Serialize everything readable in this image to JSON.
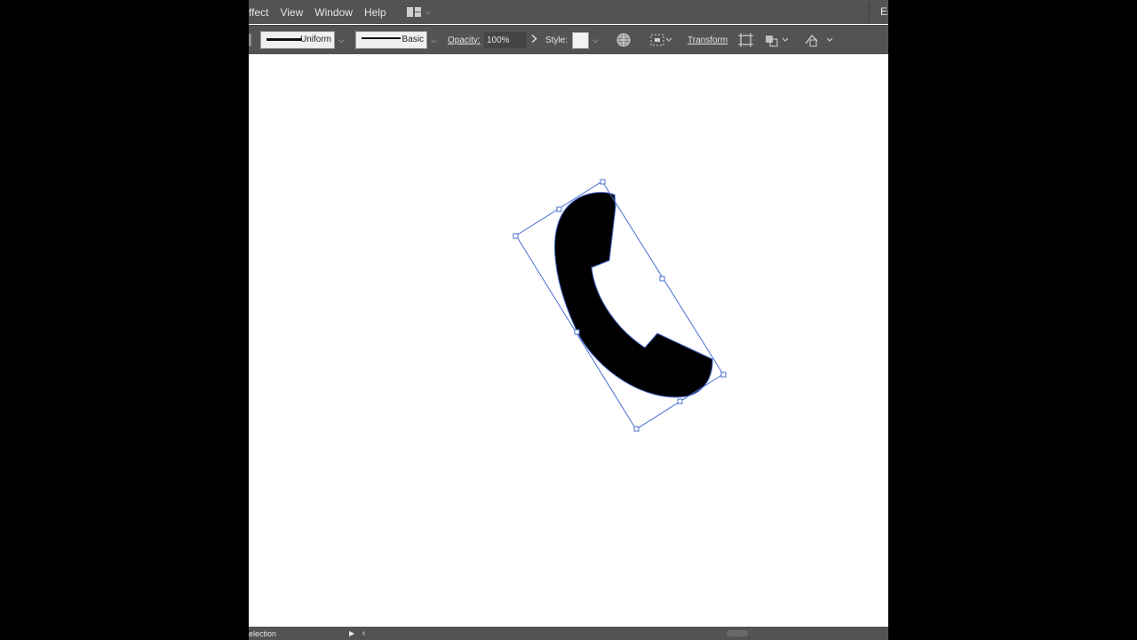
{
  "menubar": {
    "items": [
      "ffect",
      "View",
      "Window",
      "Help"
    ],
    "right_text": "Es"
  },
  "controlbar": {
    "stroke_profile_label": "Uniform",
    "brush_label": "Basic",
    "opacity_label": "Opacity:",
    "opacity_value": "100%",
    "style_label": "Style:",
    "transform_label": "Transform"
  },
  "statusbar": {
    "tool_label": "election"
  },
  "icons": [
    "workspace-switcher-icon",
    "chevron-down-icon",
    "chevron-right-icon",
    "recolor-globe-icon",
    "align-icon",
    "isolate-icon",
    "distribute-icon",
    "puppet-warp-icon",
    "play-icon",
    "back-icon",
    "telephone-handset-icon"
  ],
  "colors": {
    "chrome": "#535353",
    "canvas": "#ffffff",
    "selection": "#4a6fd0",
    "artwork_fill": "#000000"
  }
}
